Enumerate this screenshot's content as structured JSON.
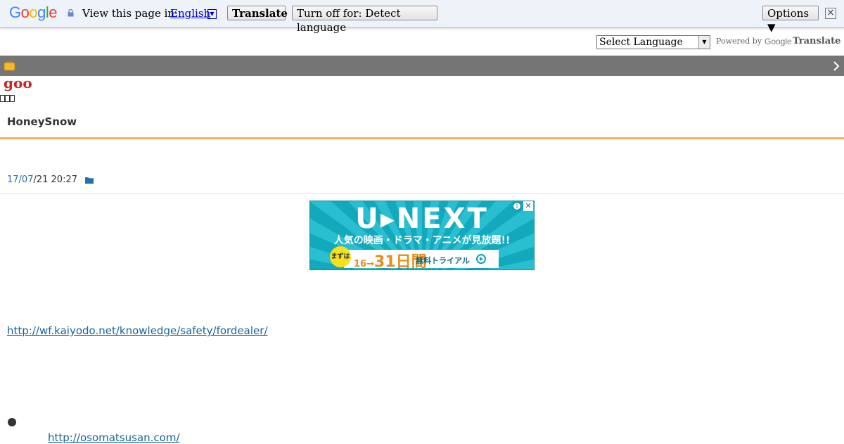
{
  "translate_bar": {
    "logo": {
      "letters": [
        "G",
        "o",
        "o",
        "g",
        "l",
        "e"
      ]
    },
    "view_label": "View this page in:",
    "language": "English",
    "translate_button": "Translate",
    "turn_off_button": "Turn off for: Detect language",
    "options_button": "Options ▼",
    "close_symbol": "×"
  },
  "language_row": {
    "select_value": "Select Language",
    "powered_by": "Powered by",
    "powered_google": "Google",
    "powered_translate": "Translate"
  },
  "blog": {
    "site_logo": "goo",
    "title": "HoneySnow",
    "post_date_link": "17/07",
    "post_date_rest": "/21 20:27"
  },
  "ad": {
    "logo": "U▸NEXT",
    "tagline": "人気の映画・ドラマ・アニメが見放題!!",
    "badge": "まずは",
    "days_prefix": "16→",
    "days_big": "31日間",
    "trial": "無料トライアル",
    "info_symbol": "i",
    "close_symbol": "✕"
  },
  "content": {
    "link1": "http://wf.kaiyodo.net/knowledge/safety/fordealer/",
    "link2": "http://osomatsusan.com/"
  },
  "colors": {
    "translate_bar_bg": "#eef2f9",
    "goo_bar_bg": "#757575",
    "accent_rule": "#f7b05a",
    "link": "#1a6496",
    "goo_logo": "#c62828"
  }
}
